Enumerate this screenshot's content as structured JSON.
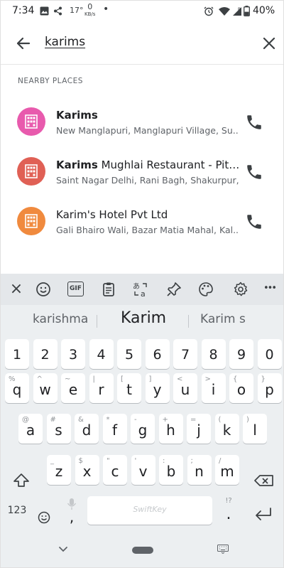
{
  "status_bar": {
    "time": "7:34",
    "temperature": "17°",
    "speed_value": "0",
    "speed_unit": "KB/s",
    "battery": "40%"
  },
  "search": {
    "query": "karims"
  },
  "section": {
    "title": "NEARBY PLACES"
  },
  "places": [
    {
      "name_bold": "Karims",
      "name_rest": "",
      "address": "New Manglapuri, Manglapuri Village, Su...",
      "icon_color": "#e85aad"
    },
    {
      "name_bold": "Karims",
      "name_rest": " Mughlai Restaurant - Pitam...",
      "address": "Saint Nagar Delhi, Rani Bagh, Shakurpur,...",
      "icon_color": "#e06055"
    },
    {
      "name_bold": "",
      "name_rest": "Karim's Hotel Pvt Ltd",
      "address": "Gali Bhairo Wali, Bazar Matia Mahal, Kal...",
      "icon_color": "#f08a3e"
    }
  ],
  "keyboard": {
    "toolbar": {
      "close": "×",
      "gif": "GIF",
      "more": "•••"
    },
    "suggestions": [
      "karishma",
      "Karim",
      "Karim s"
    ],
    "number_row": [
      "1",
      "2",
      "3",
      "4",
      "5",
      "6",
      "7",
      "8",
      "9",
      "0"
    ],
    "row1": [
      {
        "k": "q",
        "a": "%"
      },
      {
        "k": "w",
        "a": "^"
      },
      {
        "k": "e",
        "a": "~"
      },
      {
        "k": "r",
        "a": "|"
      },
      {
        "k": "t",
        "a": "["
      },
      {
        "k": "y",
        "a": "]"
      },
      {
        "k": "u",
        "a": "<"
      },
      {
        "k": "i",
        "a": ">"
      },
      {
        "k": "o",
        "a": "{"
      },
      {
        "k": "p",
        "a": "}"
      }
    ],
    "row2": [
      {
        "k": "a",
        "a": "@"
      },
      {
        "k": "s",
        "a": "#"
      },
      {
        "k": "d",
        "a": "&"
      },
      {
        "k": "f",
        "a": "*"
      },
      {
        "k": "g",
        "a": "-"
      },
      {
        "k": "h",
        "a": "+"
      },
      {
        "k": "j",
        "a": "="
      },
      {
        "k": "k",
        "a": "("
      },
      {
        "k": "l",
        "a": ")"
      }
    ],
    "row3": [
      {
        "k": "z",
        "a": "_"
      },
      {
        "k": "x",
        "a": "$"
      },
      {
        "k": "c",
        "a": "\""
      },
      {
        "k": "v",
        "a": "'"
      },
      {
        "k": "b",
        "a": ":"
      },
      {
        "k": "n",
        "a": ";"
      },
      {
        "k": "m",
        "a": "/"
      }
    ],
    "symbols_label": "123",
    "comma": ",",
    "period": ".",
    "space_brand": "SwiftKey",
    "period_alt": "!?"
  }
}
